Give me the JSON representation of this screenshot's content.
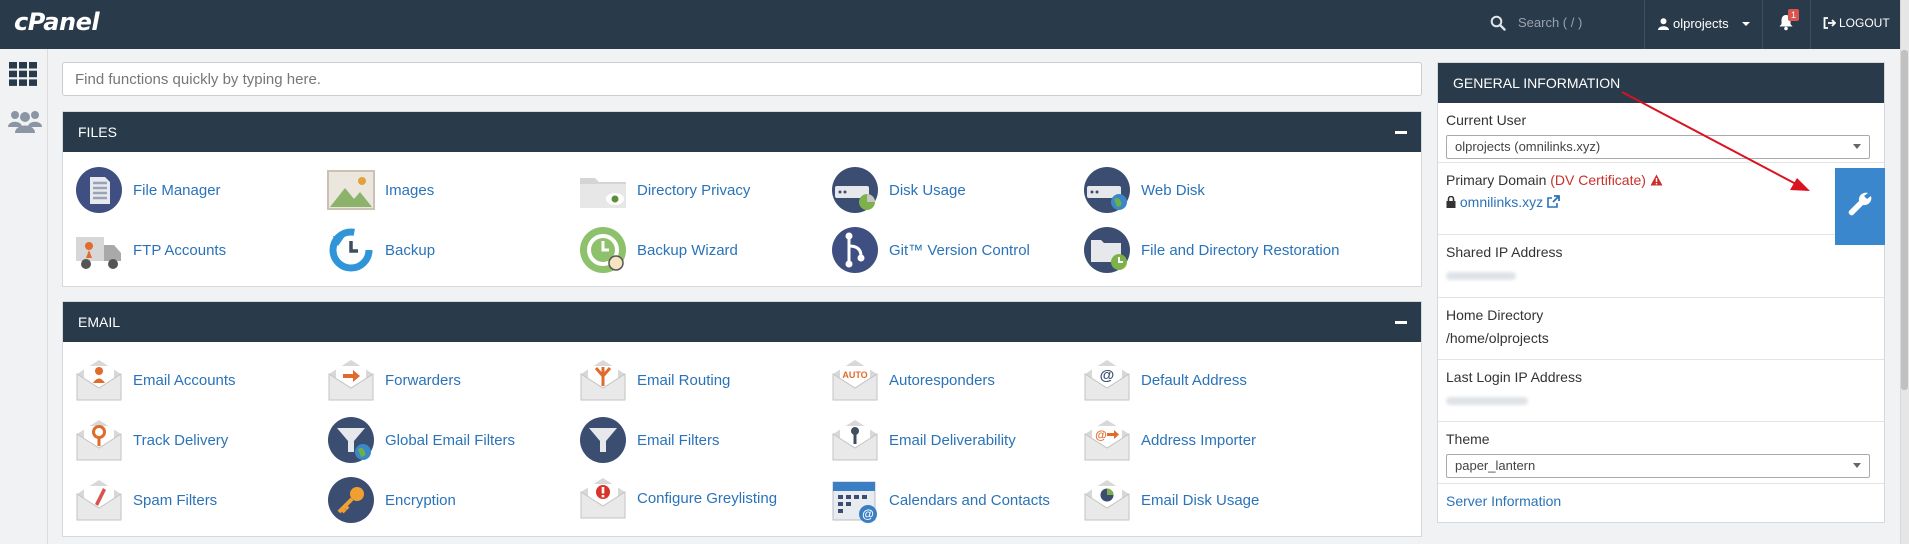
{
  "brand": {
    "logo": "cPanel"
  },
  "topbar": {
    "search_placeholder": "Search ( / )",
    "user": "olprojects",
    "notification_count": "1",
    "logout": "LOGOUT"
  },
  "quickfind": {
    "placeholder": "Find functions quickly by typing here."
  },
  "files": {
    "title": "FILES",
    "items": [
      {
        "label": "File Manager",
        "icon": "file-manager-icon"
      },
      {
        "label": "Images",
        "icon": "images-icon"
      },
      {
        "label": "Directory Privacy",
        "icon": "directory-privacy-icon"
      },
      {
        "label": "Disk Usage",
        "icon": "disk-usage-icon"
      },
      {
        "label": "Web Disk",
        "icon": "web-disk-icon"
      },
      {
        "label": "FTP Accounts",
        "icon": "ftp-truck-icon"
      },
      {
        "label": "Backup",
        "icon": "backup-icon"
      },
      {
        "label": "Backup Wizard",
        "icon": "backup-wizard-icon"
      },
      {
        "label": "Git™ Version Control",
        "icon": "git-icon"
      },
      {
        "label": "File and Directory Restoration",
        "icon": "restore-folder-icon"
      }
    ]
  },
  "email": {
    "title": "EMAIL",
    "items": [
      {
        "label": "Email Accounts",
        "icon": "email-accounts-icon"
      },
      {
        "label": "Forwarders",
        "icon": "forwarders-icon"
      },
      {
        "label": "Email Routing",
        "icon": "email-routing-icon"
      },
      {
        "label": "Autoresponders",
        "icon": "autoresponders-icon",
        "badge": "AUTO"
      },
      {
        "label": "Default Address",
        "icon": "default-address-icon"
      },
      {
        "label": "Track Delivery",
        "icon": "track-delivery-icon"
      },
      {
        "label": "Global Email Filters",
        "icon": "global-filters-icon"
      },
      {
        "label": "Email Filters",
        "icon": "email-filters-icon"
      },
      {
        "label": "Email Deliverability",
        "icon": "email-deliverability-icon"
      },
      {
        "label": "Address Importer",
        "icon": "address-importer-icon"
      },
      {
        "label": "Spam Filters",
        "icon": "spam-filters-icon"
      },
      {
        "label": "Encryption",
        "icon": "encryption-key-icon"
      },
      {
        "label": "Configure Greylisting",
        "icon": "greylisting-icon"
      },
      {
        "label": "Calendars and Contacts",
        "icon": "calendar-icon"
      },
      {
        "label": "Email Disk Usage",
        "icon": "email-disk-usage-icon"
      }
    ]
  },
  "general_info": {
    "title": "GENERAL INFORMATION",
    "current_user_label": "Current User",
    "current_user_value": "olprojects (omnilinks.xyz)",
    "primary_domain_label": "Primary Domain",
    "primary_domain_cert": "(DV Certificate)",
    "primary_domain_value": "omnilinks.xyz",
    "shared_ip_label": "Shared IP Address",
    "home_dir_label": "Home Directory",
    "home_dir_value": "/home/olprojects",
    "last_login_label": "Last Login IP Address",
    "theme_label": "Theme",
    "theme_value": "paper_lantern",
    "server_info_link": "Server Information"
  },
  "colors": {
    "header": "#293a4a",
    "link": "#2a73b9",
    "accent": "#3a87cd",
    "warning": "#c9302c",
    "annotation": "#d9131f"
  }
}
